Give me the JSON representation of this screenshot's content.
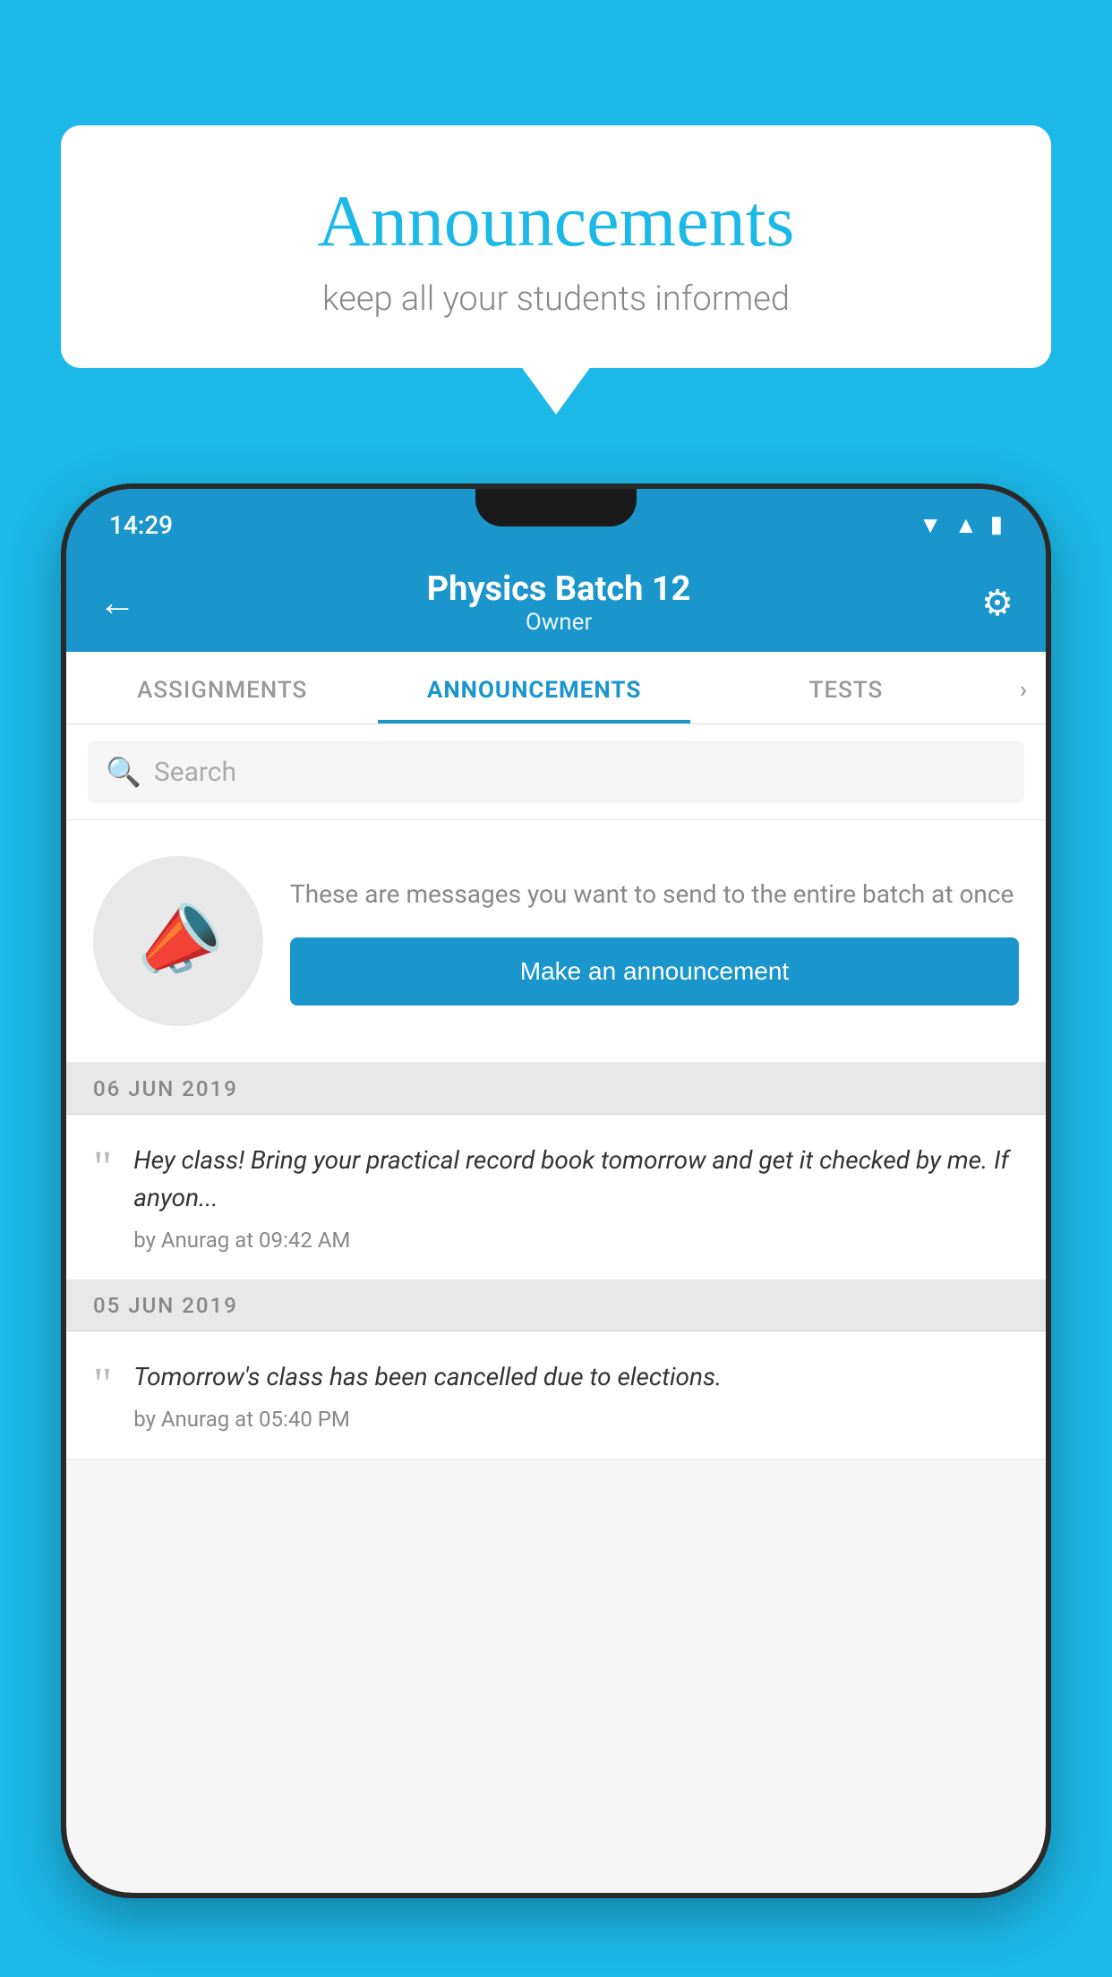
{
  "background_color": "#1BB8E8",
  "speech_bubble": {
    "title": "Announcements",
    "subtitle": "keep all your students informed"
  },
  "phone": {
    "status_bar": {
      "time": "14:29",
      "wifi": "▲",
      "signal": "▲",
      "battery": "▌"
    },
    "header": {
      "title": "Physics Batch 12",
      "subtitle": "Owner",
      "back_label": "←",
      "gear_label": "⚙"
    },
    "tabs": [
      {
        "label": "ASSIGNMENTS",
        "active": false
      },
      {
        "label": "ANNOUNCEMENTS",
        "active": true
      },
      {
        "label": "TESTS",
        "active": false
      },
      {
        "label": "›",
        "active": false
      }
    ],
    "search": {
      "placeholder": "Search"
    },
    "announcement_prompt": {
      "description": "These are messages you want to send to the entire batch at once",
      "button_label": "Make an announcement"
    },
    "announcements": [
      {
        "date": "06  JUN  2019",
        "text": "Hey class! Bring your practical record book tomorrow and get it checked by me. If anyon...",
        "meta": "by Anurag at 09:42 AM"
      },
      {
        "date": "05  JUN  2019",
        "text": "Tomorrow's class has been cancelled due to elections.",
        "meta": "by Anurag at 05:40 PM"
      }
    ]
  }
}
